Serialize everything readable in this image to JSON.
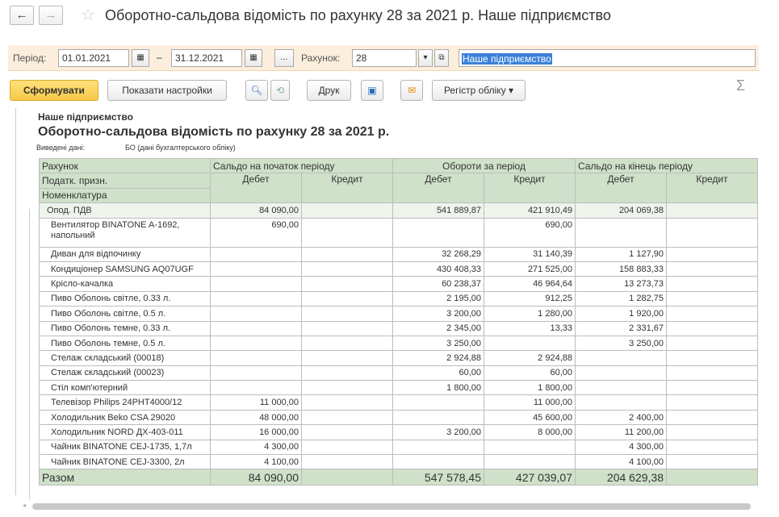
{
  "window": {
    "title": "Оборотно-сальдова відомість по рахунку 28 за 2021 р. Наше підприємство",
    "back": "←",
    "forward": "→",
    "star": "☆"
  },
  "params": {
    "period_label": "Період:",
    "date_from": "01.01.2021",
    "dash": "–",
    "date_to": "31.12.2021",
    "dots": "...",
    "account_label": "Рахунок:",
    "account": "28",
    "organization": "Наше підприємство"
  },
  "toolbar": {
    "form_label": "Сформувати",
    "settings_label": "Показати настройки",
    "print_label": "Друк",
    "register_label": "Регістр обліку ▾",
    "sigma": "Σ"
  },
  "report": {
    "organization": "Наше підприємство",
    "title": "Оборотно-сальдова відомість по рахунку 28 за 2021 р.",
    "entered_label": "Виведені дані:",
    "entered_value": "БО (дані бухгалтерського обліку)",
    "headers": {
      "account": "Рахунок",
      "tax": "Податк. призн.",
      "nomenclature": "Номенклатура",
      "opening": "Сальдо на початок періоду",
      "turnover": "Обороти за період",
      "closing": "Сальдо на кінець періоду",
      "debit": "Дебет",
      "credit": "Кредит"
    },
    "group": {
      "name": "Опод. ПДВ",
      "values": [
        "84 090,00",
        "",
        "541 889,87",
        "421 910,49",
        "204 069,38",
        ""
      ]
    },
    "rows": [
      {
        "name": "Вентилятор BINATONE A-1692, напольний",
        "values": [
          "690,00",
          "",
          "",
          "690,00",
          "",
          ""
        ]
      },
      {
        "name": "Диван для відпочинку",
        "values": [
          "",
          "",
          "32 268,29",
          "31 140,39",
          "1 127,90",
          ""
        ]
      },
      {
        "name": "Кондиціонер SAMSUNG AQ07UGF",
        "values": [
          "",
          "",
          "430 408,33",
          "271 525,00",
          "158 883,33",
          ""
        ]
      },
      {
        "name": "Крісло-качалка",
        "values": [
          "",
          "",
          "60 238,37",
          "46 964,64",
          "13 273,73",
          ""
        ]
      },
      {
        "name": "Пиво Оболонь світле, 0.33 л.",
        "values": [
          "",
          "",
          "2 195,00",
          "912,25",
          "1 282,75",
          ""
        ]
      },
      {
        "name": "Пиво Оболонь світле, 0.5 л.",
        "values": [
          "",
          "",
          "3 200,00",
          "1 280,00",
          "1 920,00",
          ""
        ]
      },
      {
        "name": "Пиво Оболонь темне, 0.33 л.",
        "values": [
          "",
          "",
          "2 345,00",
          "13,33",
          "2 331,67",
          ""
        ]
      },
      {
        "name": "Пиво Оболонь темне, 0.5 л.",
        "values": [
          "",
          "",
          "3 250,00",
          "",
          "3 250,00",
          ""
        ]
      },
      {
        "name": "Стелаж складський (00018)",
        "values": [
          "",
          "",
          "2 924,88",
          "2 924,88",
          "",
          ""
        ]
      },
      {
        "name": "Стелаж складський (00023)",
        "values": [
          "",
          "",
          "60,00",
          "60,00",
          "",
          ""
        ]
      },
      {
        "name": "Стіл комп'ютерний",
        "values": [
          "",
          "",
          "1 800,00",
          "1 800,00",
          "",
          ""
        ]
      },
      {
        "name": "Телевізор Philips 24PHT4000/12",
        "values": [
          "11 000,00",
          "",
          "",
          "11 000,00",
          "",
          ""
        ]
      },
      {
        "name": "Холодильник Beko CSA 29020",
        "values": [
          "48 000,00",
          "",
          "",
          "45 600,00",
          "2 400,00",
          ""
        ]
      },
      {
        "name": "Холодильник NORD ДХ-403-011",
        "values": [
          "16 000,00",
          "",
          "3 200,00",
          "8 000,00",
          "11 200,00",
          ""
        ]
      },
      {
        "name": "Чайник BINATONE CEJ-1735, 1,7л",
        "values": [
          "4 300,00",
          "",
          "",
          "",
          "4 300,00",
          ""
        ]
      },
      {
        "name": "Чайник BINATONE CEJ-3300, 2л",
        "values": [
          "4 100,00",
          "",
          "",
          "",
          "4 100,00",
          ""
        ]
      }
    ],
    "total": {
      "name": "Разом",
      "values": [
        "84 090,00",
        "",
        "547 578,45",
        "427 039,07",
        "204 629,38",
        ""
      ]
    }
  },
  "colors": {
    "header_bg": "#cfe1c9",
    "params_bg": "#fbeedc",
    "primary_button": "#f7c948",
    "selection": "#3a80d9"
  }
}
